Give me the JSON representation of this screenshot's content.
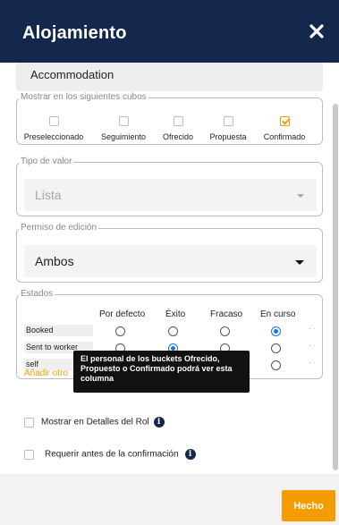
{
  "header": {
    "title": "Alojamiento",
    "close_icon": "close-icon"
  },
  "name_field": {
    "value": "Accommodation"
  },
  "cubes": {
    "legend": "Mostrar en los siguientes cubos",
    "options": [
      {
        "label": "Preseleccionado",
        "checked": false
      },
      {
        "label": "Seguimiento",
        "checked": false
      },
      {
        "label": "Ofrecido",
        "checked": false
      },
      {
        "label": "Propuesta",
        "checked": false
      },
      {
        "label": "Confirmado",
        "checked": true
      }
    ]
  },
  "tipo_valor": {
    "legend": "Tipo de valor",
    "value": "Lista"
  },
  "permiso": {
    "legend": "Permiso de edición",
    "value": "Ambos"
  },
  "estados": {
    "legend": "Estados",
    "columns": [
      "Por defecto",
      "Éxito",
      "Fracaso",
      "En curso"
    ],
    "rows": [
      {
        "label": "Booked",
        "selected": "En curso"
      },
      {
        "label": "Sent to worker",
        "selected": "Éxito"
      },
      {
        "label": "self",
        "selected": "Por defecto"
      }
    ],
    "add_link": "Añadir otro"
  },
  "tooltip": {
    "text": "El personal de los buckets Ofrecido, Propuesto o Confirmado podrá ver esta columna"
  },
  "options": {
    "show_in_role": {
      "label": "Mostrar en Detalles del Rol",
      "checked": false
    },
    "require_before": {
      "label": "Requerir antes de la confirmación",
      "checked": false
    }
  },
  "footer": {
    "done_label": "Hecho"
  },
  "colors": {
    "header_bg": "#14284d",
    "accent": "#f59c00",
    "radio_on": "#1a73e8"
  }
}
